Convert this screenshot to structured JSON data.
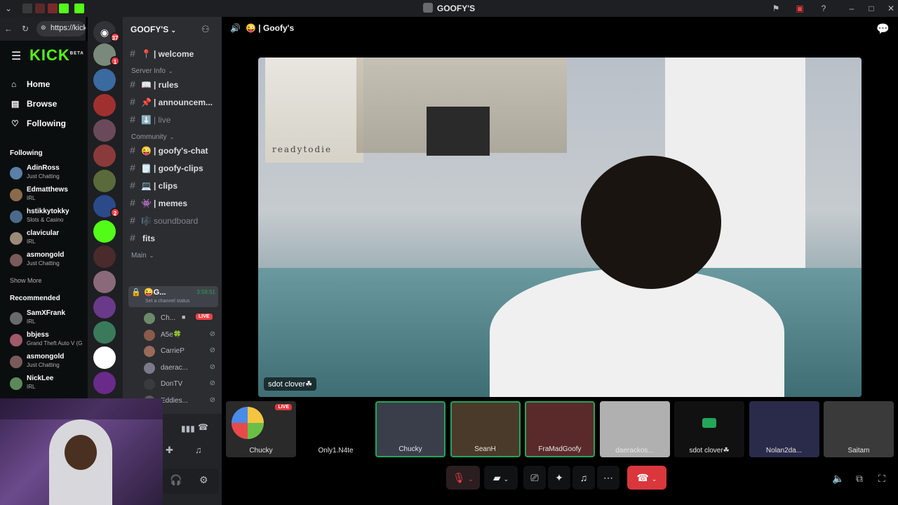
{
  "window": {
    "title": "GOOFY'S"
  },
  "browser": {
    "url": "https://kick.c"
  },
  "kick": {
    "logo": "KICK",
    "logo_sup": "BETA",
    "nav": [
      {
        "label": "Home"
      },
      {
        "label": "Browse"
      },
      {
        "label": "Following"
      }
    ],
    "following_title": "Following",
    "following": [
      {
        "name": "AdinRoss",
        "category": "Just Chatting",
        "color": "#5a7fa8"
      },
      {
        "name": "Edmatthews",
        "category": "IRL",
        "color": "#8a6a4a"
      },
      {
        "name": "hstikkytokky",
        "category": "Slots & Casino",
        "color": "#4a6a8a"
      },
      {
        "name": "clavicular",
        "category": "IRL",
        "color": "#9a8a7a"
      },
      {
        "name": "asmongold",
        "category": "Just Chatting",
        "color": "#7a5a5a"
      }
    ],
    "show_more": "Show More",
    "recommended_title": "Recommended",
    "recommended": [
      {
        "name": "SamXFrank",
        "category": "IRL",
        "color": "#6a6a6a"
      },
      {
        "name": "bbjess",
        "category": "Grand Theft Auto V (G",
        "color": "#a05a6a"
      },
      {
        "name": "asmongold",
        "category": "Just Chatting",
        "color": "#7a5a5a"
      },
      {
        "name": "NickLee",
        "category": "IRL",
        "color": "#5a8a5a"
      }
    ]
  },
  "rail": {
    "home_badge": "37",
    "servers": [
      {
        "color": "#7a8a7a",
        "badge": "1"
      },
      {
        "color": "#3a6aa0",
        "badge": ""
      },
      {
        "color": "#a03030",
        "badge": ""
      },
      {
        "color": "#6a4a5a",
        "badge": ""
      },
      {
        "color": "#8a3a3a",
        "badge": ""
      },
      {
        "color": "#5a6a3a",
        "badge": ""
      },
      {
        "color": "#2a4a8a",
        "badge": "2"
      },
      {
        "color": "#53fc18",
        "badge": ""
      },
      {
        "color": "#4a2a2a",
        "badge": ""
      },
      {
        "color": "#8a6a7a",
        "badge": ""
      },
      {
        "color": "#6a3a8a",
        "badge": ""
      },
      {
        "color": "#3a7a5a",
        "badge": ""
      },
      {
        "color": "#ffffff",
        "badge": ""
      },
      {
        "color": "#6a2a8a",
        "badge": ""
      }
    ]
  },
  "channels": {
    "server_name": "GOOFY'S",
    "list": [
      {
        "emoji": "📍",
        "name": "| welcome",
        "muted": false
      },
      {
        "type": "category",
        "name": "Server Info"
      },
      {
        "emoji": "📖",
        "name": "| rules",
        "muted": false
      },
      {
        "emoji": "📌",
        "name": "| announcem...",
        "muted": false
      },
      {
        "emoji": "⬇️",
        "name": "| live",
        "muted": true
      },
      {
        "type": "category",
        "name": "Community"
      },
      {
        "emoji": "😜",
        "name": "| goofy's-chat",
        "muted": false
      },
      {
        "emoji": "🗒️",
        "name": "| goofy-clips",
        "muted": false
      },
      {
        "emoji": "💻",
        "name": "| clips",
        "muted": false
      },
      {
        "emoji": "👾",
        "name": "| memes",
        "muted": false
      },
      {
        "emoji": "🎼",
        "name": "soundboard",
        "muted": true
      },
      {
        "emoji": "",
        "name": "fits",
        "muted": false
      },
      {
        "type": "category",
        "name": "Main"
      }
    ],
    "voice": {
      "name": "G...",
      "timer": "3:59:51",
      "status": "Set a channel status",
      "live_badge": "LIVE",
      "users": [
        {
          "name": "Ch...",
          "color": "#6a8a6a"
        },
        {
          "name": "A5e🍀",
          "color": "#8a5a4a"
        },
        {
          "name": "CarrieP",
          "color": "#9a6a5a"
        },
        {
          "name": "daerac...",
          "color": "#7a7a8a"
        },
        {
          "name": "DonTV",
          "color": "#3a3a3a"
        },
        {
          "name": "Eddies...",
          "color": "#5a5a5a"
        }
      ]
    }
  },
  "main": {
    "header_title": "| Goofy's",
    "header_emoji": "😜",
    "focused_label": "sdot clover☘",
    "poster_text": "readytodie",
    "tiles": [
      {
        "label": "Chucky",
        "bg": "#2a2a2a",
        "speaking": false
      },
      {
        "label": "Only1.N4te",
        "bg": "#000000",
        "speaking": false
      },
      {
        "label": "Chucky",
        "bg": "#3a3e4a",
        "speaking": true
      },
      {
        "label": "SeanH",
        "bg": "#4a3a2a",
        "speaking": true
      },
      {
        "label": "FraMadGoofy",
        "bg": "#5a2a2a",
        "speaking": true
      },
      {
        "label": "daerackos...",
        "bg": "#b0b0b0",
        "speaking": false
      },
      {
        "label": "sdot clover☘",
        "bg": "#111111",
        "speaking": false
      },
      {
        "label": "Nolan2da...",
        "bg": "#2a2a4a",
        "speaking": false
      },
      {
        "label": "Saitam",
        "bg": "#3a3a3a",
        "speaking": false
      }
    ],
    "live_badge": "LIVE"
  },
  "colors": {
    "kick_green": "#53fc18",
    "discord_red": "#da373c",
    "speaking_green": "#23a55a"
  }
}
